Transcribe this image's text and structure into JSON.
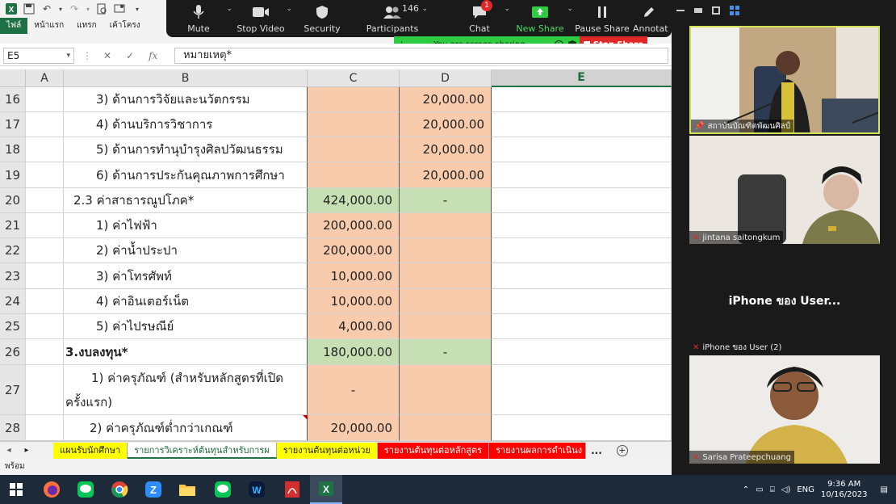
{
  "excel": {
    "ribbon_tabs": [
      "ไฟล์",
      "หน้าแรก",
      "แทรก",
      "เค้าโครง"
    ],
    "name_box": "E5",
    "formula": "หมายเหตุ*",
    "columns": [
      "A",
      "B",
      "C",
      "D",
      "E"
    ],
    "rows": [
      {
        "num": "16",
        "b": "3) ด้านการวิจัยและนวัตกรรม",
        "c": "",
        "d": "20,000.00"
      },
      {
        "num": "17",
        "b": "4) ด้านบริการวิชาการ",
        "c": "",
        "d": "20,000.00"
      },
      {
        "num": "18",
        "b": "5) ด้านการทำนุบำรุงศิลปวัฒนธรรม",
        "c": "",
        "d": "20,000.00"
      },
      {
        "num": "19",
        "b": "6) ด้านการประกันคุณภาพการศึกษา",
        "c": "",
        "d": "20,000.00"
      },
      {
        "num": "20",
        "b": "2.3 ค่าสาธารณูปโภค*",
        "c": "424,000.00",
        "d": "-"
      },
      {
        "num": "21",
        "b": "1) ค่าไฟฟ้า",
        "c": "200,000.00",
        "d": ""
      },
      {
        "num": "22",
        "b": "2) ค่าน้ำประปา",
        "c": "200,000.00",
        "d": ""
      },
      {
        "num": "23",
        "b": "3) ค่าโทรศัพท์",
        "c": "10,000.00",
        "d": ""
      },
      {
        "num": "24",
        "b": "4) ค่าอินเตอร์เน็ต",
        "c": "10,000.00",
        "d": ""
      },
      {
        "num": "25",
        "b": "5) ค่าไปรษณีย์",
        "c": "4,000.00",
        "d": ""
      },
      {
        "num": "26",
        "b": "3.งบลงทุน*",
        "c": "180,000.00",
        "d": "-"
      },
      {
        "num": "27",
        "b1": "1) ค่าครุภัณฑ์ (สำหรับหลักสูตรที่เปิด",
        "b2": "ครั้งแรก)",
        "c": "-",
        "d": ""
      },
      {
        "num": "28",
        "b": "2) ค่าครุภัณฑ์ต่ำกว่าเกณฑ์",
        "c": "20,000.00",
        "d": ""
      }
    ],
    "sheet_tabs": [
      "แผนรับนักศึกษา",
      "รายการวิเคราะห์ต้นทุนสำหรับการผ",
      "รายงานต้นทุนต่อหน่วย",
      "รายงานต้นทุนต่อหลักสูตร",
      "รายงานผลการดำเนินง"
    ],
    "sheet_more": "...",
    "status": "พร้อม"
  },
  "zoom": {
    "toolbar": [
      {
        "label": "Mute"
      },
      {
        "label": "Stop Video"
      },
      {
        "label": "Security"
      },
      {
        "label": "Participants",
        "count": "146"
      },
      {
        "label": "Chat",
        "badge": "1"
      },
      {
        "label": "New Share"
      },
      {
        "label": "Pause Share"
      },
      {
        "label": "Annotat"
      }
    ],
    "sharing_text": "You are screen sharing",
    "stop_share": "Stop Share",
    "participants": [
      {
        "name": "สถาบันบัณฑิตพัฒนศิลป์"
      },
      {
        "name": "jintana saitongkum"
      },
      {
        "name": "iPhone ของ User (2)",
        "display": "iPhone ของ User..."
      },
      {
        "name": "Sarisa Prateepchuang"
      }
    ]
  },
  "taskbar": {
    "lang": "ENG",
    "time": "9:36 AM",
    "date": "10/16/2023"
  },
  "colors": {
    "excel_green": "#217346",
    "cell_peach": "#f8cbad",
    "cell_green": "#c6e0b4",
    "zoom_share_green": "#2ecc40",
    "zoom_stop_red": "#e02828",
    "participant_badge_red": "#e02828"
  }
}
